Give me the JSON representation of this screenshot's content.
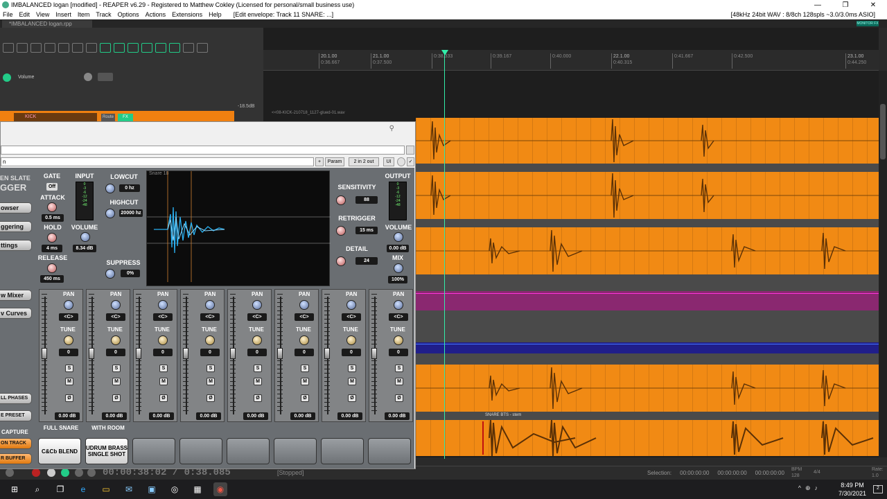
{
  "titlebar": {
    "title": "IMBALANCED logan [modified] - REAPER v6.29 - Registered to Matthew Cokley (Licensed for personal/small business use)"
  },
  "menu": {
    "items": [
      "File",
      "Edit",
      "View",
      "Insert",
      "Item",
      "Track",
      "Options",
      "Actions",
      "Extensions",
      "Help"
    ],
    "envelope": "[Edit envelope: Track 11 SNARE: ...]",
    "audio": "[48kHz 24bit WAV : 8/8ch 128spls ~3.0/3.0ms ASIO]"
  },
  "project_tab": "*IMBALANCED logan.rpp",
  "monitor_fx": "MONITOR FX",
  "tcp": {
    "envelope_label": "Volume",
    "db_readout": "-18.5dB",
    "kick_label": "KICK",
    "route": "Route",
    "fx": "FX"
  },
  "ruler": {
    "ticks": [
      {
        "top": "20.1.00",
        "bottom": "0:36.667"
      },
      {
        "top": "21.1.00",
        "bottom": "0:37.500"
      },
      {
        "top": "",
        "bottom": "0:38.333"
      },
      {
        "top": "",
        "bottom": "0:39.167"
      },
      {
        "top": "",
        "bottom": "0:40.000"
      },
      {
        "top": "22.1.00",
        "bottom": "0:40.315"
      },
      {
        "top": "",
        "bottom": "0:41.667"
      },
      {
        "top": "",
        "bottom": "0:42.500"
      },
      {
        "top": "23.1.00",
        "bottom": "0:44.250"
      }
    ]
  },
  "clips": {
    "kick_clip": "<<08-KICK-210718_1127-glued-01.wav",
    "snare_clip": "SNARE BTS - stem"
  },
  "plugin": {
    "preset": "n",
    "param_btn": "Param",
    "io_btn": "2 in 2 out",
    "ui_btn": "UI",
    "plus_btn": "+",
    "brand_top": "EN SLATE",
    "brand_bottom": "GGER",
    "left_buttons": [
      "owser",
      "ggering",
      "ttings",
      "w Mixer",
      "v Curves",
      "LL PHASES",
      "E PRESET"
    ],
    "capture": "CAPTURE",
    "capture_btn": "ON TRACK",
    "capture_btn2": "R BUFFER",
    "gate": {
      "label": "GATE",
      "state": "Off",
      "attack_label": "ATTACK",
      "attack": "0.5 ms",
      "hold_label": "HOLD",
      "hold": "4 ms",
      "release_label": "RELEASE",
      "release": "450 ms"
    },
    "input": {
      "label": "INPUT",
      "volume_label": "VOLUME",
      "volume": "8.34 dB",
      "scale": [
        "0",
        "-3",
        "-6",
        "-12",
        "-24",
        "-48"
      ]
    },
    "filters": {
      "lowcut_label": "LOWCUT",
      "lowcut": "0 hz",
      "highcut_label": "HIGHCUT",
      "highcut": "20000 hz",
      "suppress_label": "SUPPRESS",
      "suppress": "0%"
    },
    "scope_label": "Snare 18",
    "sensitivity": {
      "label": "SENSITIVITY",
      "value": "88"
    },
    "retrigger": {
      "label": "RETRIGGER",
      "value": "15 ms"
    },
    "detail": {
      "label": "DETAIL",
      "value": "24"
    },
    "output": {
      "label": "OUTPUT",
      "volume_label": "VOLUME",
      "volume": "0.00 dB",
      "mix_label": "MIX",
      "mix": "100%",
      "scale": [
        "0",
        "-3",
        "-6",
        "-12",
        "-24",
        "-48"
      ]
    },
    "channels": [
      {
        "pan": "<C>",
        "tune": "0",
        "db": "0.00 dB",
        "name": "FULL SNARE"
      },
      {
        "pan": "<C>",
        "tune": "0",
        "db": "0.00 dB",
        "name": "WITH ROOM"
      },
      {
        "pan": "<C>",
        "tune": "0",
        "db": "0.00 dB",
        "name": ""
      },
      {
        "pan": "<C>",
        "tune": "0",
        "db": "0.00 dB",
        "name": ""
      },
      {
        "pan": "<C>",
        "tune": "0",
        "db": "0.00 dB",
        "name": ""
      },
      {
        "pan": "<C>",
        "tune": "0",
        "db": "0.00 dB",
        "name": ""
      },
      {
        "pan": "<C>",
        "tune": "0",
        "db": "0.00 dB",
        "name": ""
      },
      {
        "pan": "<C>",
        "tune": "0",
        "db": "0.00 dB",
        "name": ""
      }
    ],
    "channel_labels": {
      "pan": "PAN",
      "tune": "TUNE",
      "solo": "S",
      "mute": "M",
      "phase": "Ø"
    },
    "pads": [
      "C&Cb BLEND",
      "UDRUM BRASS SINGLE SHOT",
      "",
      "",
      "",
      "",
      "",
      ""
    ]
  },
  "transport": {
    "time": "00:00:38:02 / 0:38.085",
    "state": "[Stopped]",
    "selection_label": "Selection:",
    "sel_values": [
      "00:00:00:00",
      "00:00:00:00",
      "00:00:00:00"
    ],
    "bpm_label": "BPM",
    "bpm": "128",
    "timesig": "4/4",
    "rate_label": "Rate:",
    "rate": "1.0"
  },
  "taskbar": {
    "time": "8:49 PM",
    "date": "7/30/2021",
    "notify": "2"
  },
  "colors": {
    "track_orange": "#f18a14",
    "accent_green": "#33cc88",
    "envelope_pink": "#8a2870",
    "envelope_blue": "#201e8a"
  }
}
